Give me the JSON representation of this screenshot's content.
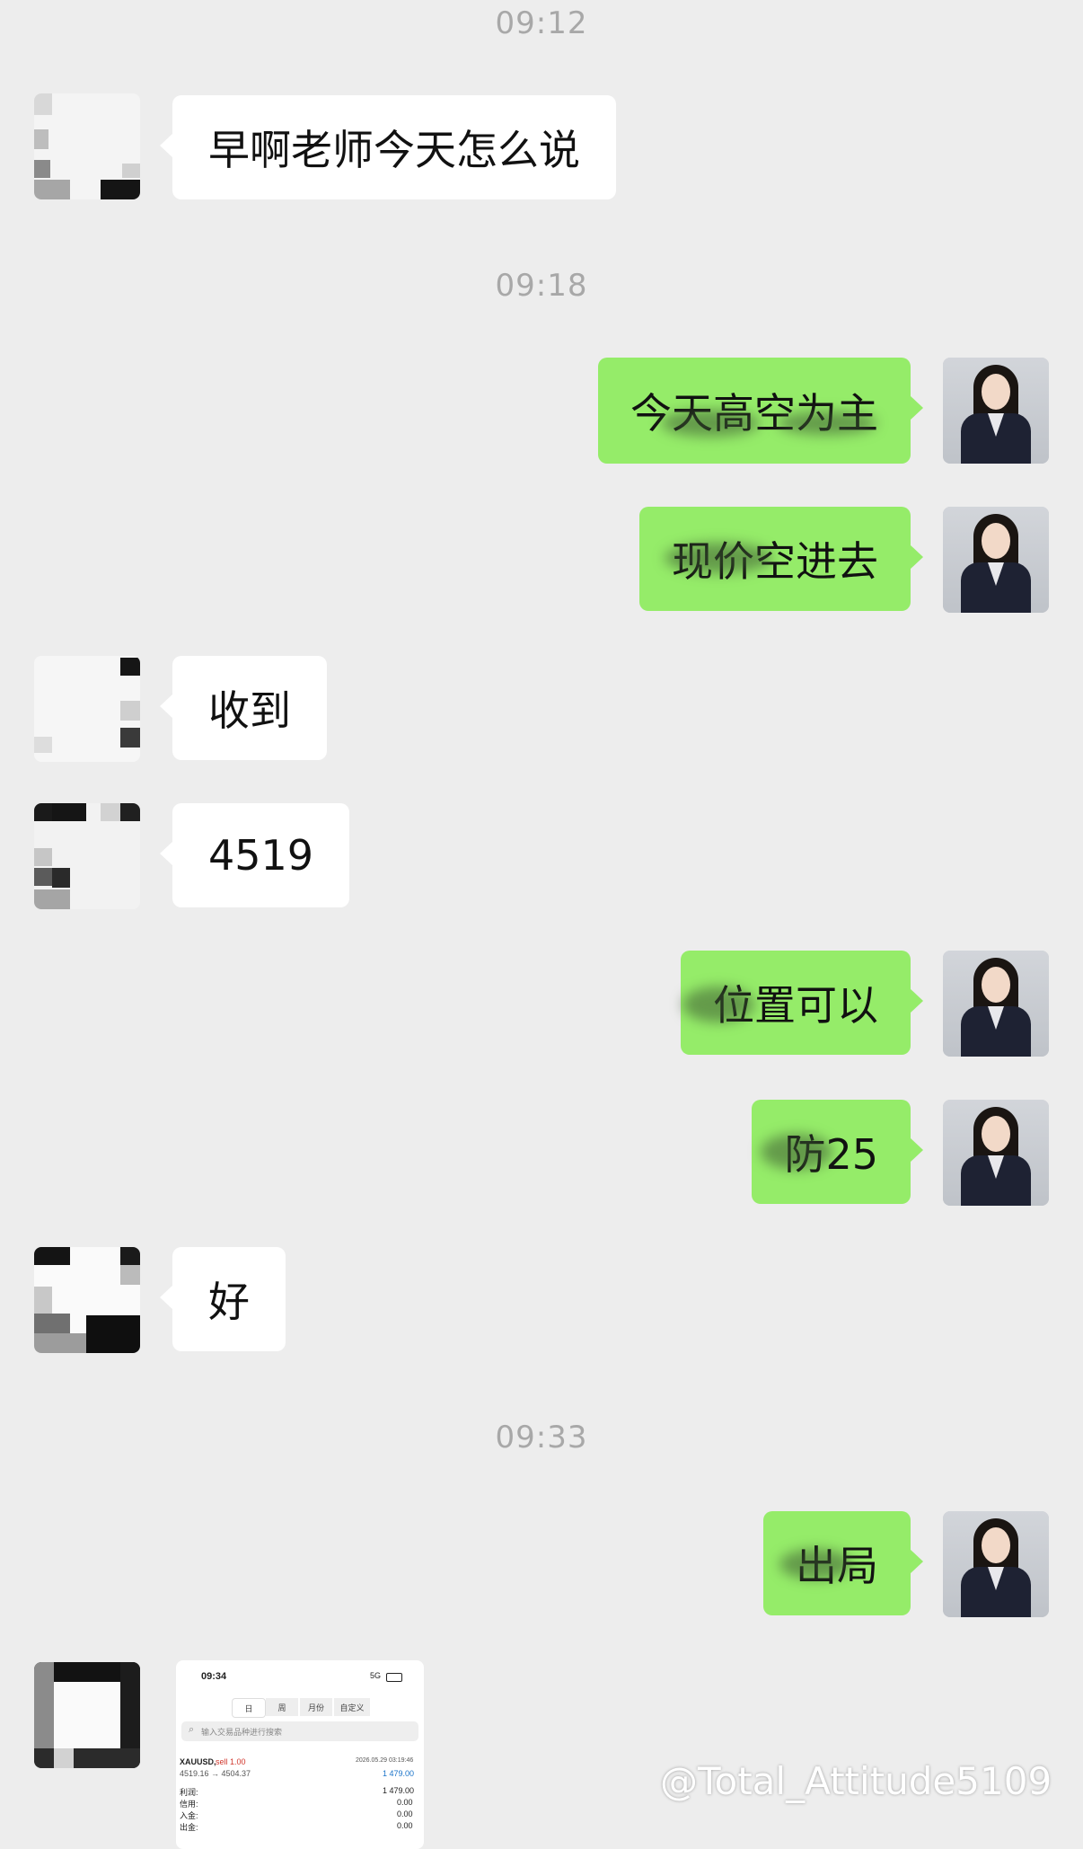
{
  "timestamps": [
    "09:12",
    "09:18",
    "09:33"
  ],
  "messages": [
    {
      "side": "in",
      "text": "早啊老师今天怎么说"
    },
    {
      "side": "out",
      "text": "今天高空为主"
    },
    {
      "side": "out",
      "text": "现价空进去"
    },
    {
      "side": "in",
      "text": "收到"
    },
    {
      "side": "in",
      "text": "4519"
    },
    {
      "side": "out",
      "text": "位置可以"
    },
    {
      "side": "out",
      "text": "防25"
    },
    {
      "side": "in",
      "text": "好"
    },
    {
      "side": "out",
      "text": "出局"
    }
  ],
  "screenshot": {
    "time": "09:34",
    "network": "5G",
    "tabs": [
      "日",
      "周",
      "月份",
      "自定义"
    ],
    "search_placeholder": "输入交易品种进行搜索",
    "symbol": "XAUUSD,",
    "side": "sell 1.00",
    "datetime": "2026.05.29 03:19:46",
    "price_move": "4519.16 → 4504.37",
    "profit_value": "1 479.00",
    "rows": [
      {
        "label": "利润:",
        "value": "1 479.00"
      },
      {
        "label": "信用:",
        "value": "0.00"
      },
      {
        "label": "入金:",
        "value": "0.00"
      },
      {
        "label": "出金:",
        "value": "0.00"
      }
    ]
  },
  "watermark": "@Total_Attitude5109",
  "colors": {
    "incoming": "#ffffff",
    "outgoing": "#95ec69",
    "background": "#ededed"
  }
}
